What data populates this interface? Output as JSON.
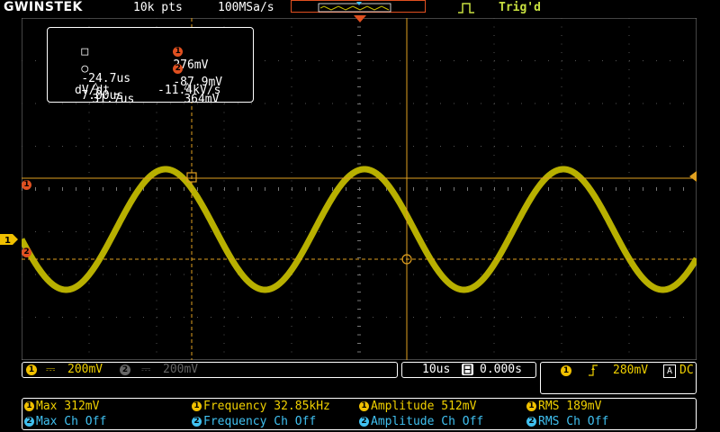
{
  "header": {
    "brand": "GWINSTEK",
    "points": "10k pts",
    "sample_rate": "100MSa/s",
    "trigger_state": "Trig'd"
  },
  "cursor_panel": {
    "h1_time": "-24.7us",
    "h1_volt": "276mV",
    "h2_time": "7.00us",
    "h2_volt": "-87.9mV",
    "delta_time": "31.7us",
    "delta_volt": "364mV",
    "dvdt_label": "dV/dt",
    "dvdt_value": "-11.4kV/s",
    "cursor1_marker": "1",
    "cursor2_marker": "2"
  },
  "channels": {
    "ch1_marker": "1",
    "ch1_scale": "200mV",
    "ch2_marker": "2",
    "ch2_scale": "200mV"
  },
  "timebase": {
    "scale": "10us",
    "position": "0.000s"
  },
  "trigger": {
    "source": "1",
    "level": "280mV",
    "mode_box": "A",
    "coupling": "DC"
  },
  "measurements": {
    "ch1": [
      {
        "label": "Max 312mV"
      },
      {
        "label": "Frequency 32.85kHz"
      },
      {
        "label": "Amplitude 512mV"
      },
      {
        "label": "RMS 189mV"
      }
    ],
    "ch2": [
      {
        "label": "Max Ch Off"
      },
      {
        "label": "Frequency Ch Off"
      },
      {
        "label": "Amplitude Ch Off"
      },
      {
        "label": "RMS Ch Off"
      }
    ]
  },
  "colors": {
    "trace": "#b8b000",
    "cursor": "#e0a020",
    "ch1": "#f0d000",
    "ch2": "#40c0f0",
    "accent": "#e05020"
  }
}
